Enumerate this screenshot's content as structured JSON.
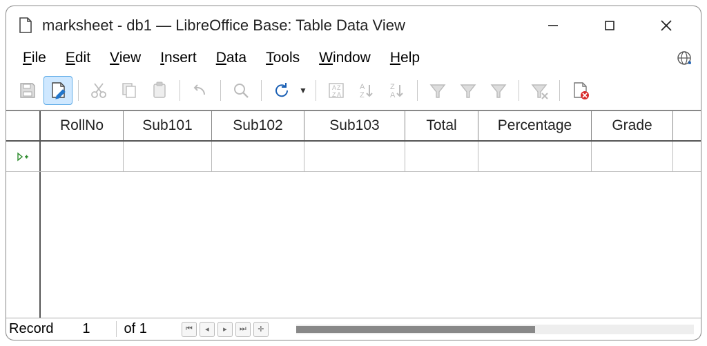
{
  "window": {
    "title": "marksheet - db1 — LibreOffice Base: Table Data View"
  },
  "menu": {
    "file": "File",
    "edit": "Edit",
    "view": "View",
    "insert": "Insert",
    "data": "Data",
    "tools": "Tools",
    "window": "Window",
    "help": "Help"
  },
  "columns": {
    "c0": "RollNo",
    "c1": "Sub101",
    "c2": "Sub102",
    "c3": "Sub103",
    "c4": "Total",
    "c5": "Percentage",
    "c6": "Grade"
  },
  "row_marker": "▹+",
  "status": {
    "label": "Record",
    "current": "1",
    "of_text": "of 1"
  }
}
